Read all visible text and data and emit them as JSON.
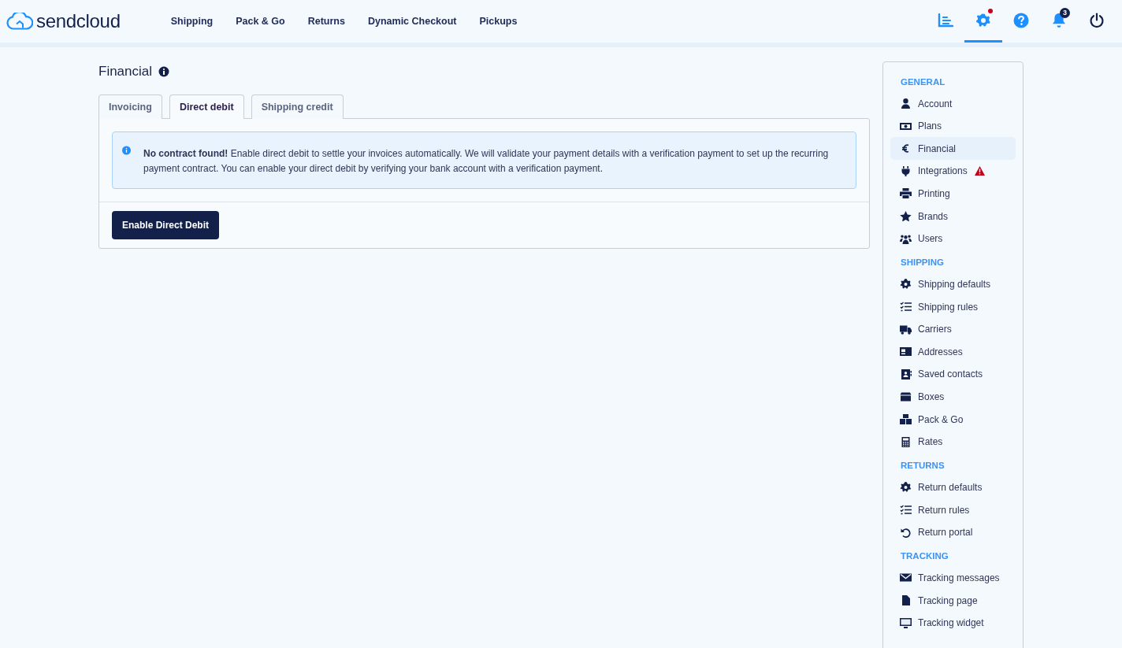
{
  "header": {
    "logo": "sendcloud",
    "nav": [
      {
        "label": "Shipping",
        "selected": false
      },
      {
        "label": "Pack & Go",
        "selected": false
      },
      {
        "label": "Returns",
        "selected": false
      },
      {
        "label": "Dynamic Checkout",
        "selected": false
      },
      {
        "label": "Pickups",
        "selected": false
      }
    ],
    "tools": [
      {
        "kind": "analytics",
        "selected": false,
        "dot": false
      },
      {
        "kind": "settings",
        "selected": true,
        "dot": true
      },
      {
        "kind": "help",
        "selected": false,
        "dot": false
      },
      {
        "kind": "notifications",
        "selected": false,
        "dot": false,
        "badge": "3"
      },
      {
        "kind": "logout",
        "selected": false,
        "dot": false
      }
    ]
  },
  "page": {
    "title": "Financial",
    "tabs": [
      {
        "label": "Invoicing",
        "selected": false
      },
      {
        "label": "Direct debit",
        "selected": true
      },
      {
        "label": "Shipping credit",
        "selected": false
      }
    ],
    "alert": {
      "text": "**No contract found!** Enable direct debit to settle your invoices automatically. We will validate your payment details with a verification payment to set up the recurring payment contract. You can enable your direct debit by verifying your bank account with a verification payment."
    },
    "button": "Enable Direct Debit"
  },
  "sidebar": {
    "sections": [
      {
        "title": "GENERAL",
        "items": [
          {
            "label": "Account",
            "selected": false,
            "warning": false
          },
          {
            "label": "Plans",
            "selected": false,
            "warning": false
          },
          {
            "label": "Financial",
            "selected": true,
            "warning": false
          },
          {
            "label": "Integrations",
            "selected": false,
            "warning": true
          },
          {
            "label": "Printing",
            "selected": false,
            "warning": false
          },
          {
            "label": "Brands",
            "selected": false,
            "warning": false
          },
          {
            "label": "Users",
            "selected": false,
            "warning": false
          }
        ]
      },
      {
        "title": "SHIPPING",
        "items": [
          {
            "label": "Shipping defaults",
            "selected": false,
            "warning": false
          },
          {
            "label": "Shipping rules",
            "selected": false,
            "warning": false
          },
          {
            "label": "Carriers",
            "selected": false,
            "warning": false
          },
          {
            "label": "Addresses",
            "selected": false,
            "warning": false
          },
          {
            "label": "Saved contacts",
            "selected": false,
            "warning": false
          },
          {
            "label": "Boxes",
            "selected": false,
            "warning": false
          },
          {
            "label": "Pack & Go",
            "selected": false,
            "warning": false
          },
          {
            "label": "Rates",
            "selected": false,
            "warning": false
          }
        ]
      },
      {
        "title": "RETURNS",
        "items": [
          {
            "label": "Return defaults",
            "selected": false,
            "warning": false
          },
          {
            "label": "Return rules",
            "selected": false,
            "warning": false
          },
          {
            "label": "Return portal",
            "selected": false,
            "warning": false
          }
        ]
      },
      {
        "title": "TRACKING",
        "items": [
          {
            "label": "Tracking messages",
            "selected": false,
            "warning": false
          },
          {
            "label": "Tracking page",
            "selected": false,
            "warning": false
          },
          {
            "label": "Tracking widget",
            "selected": false,
            "warning": false
          }
        ]
      }
    ]
  }
}
